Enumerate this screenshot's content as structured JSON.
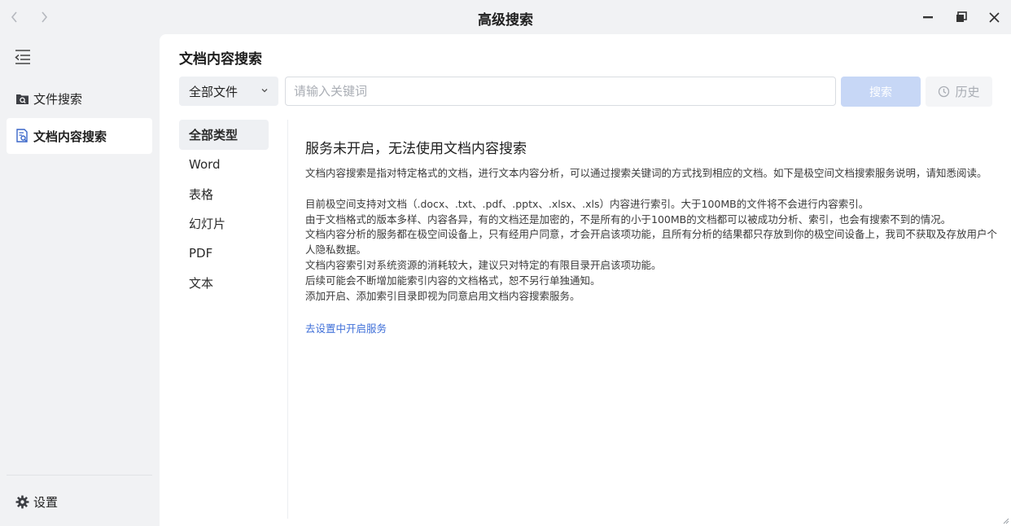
{
  "window": {
    "title": "高级搜索",
    "back_icon": "chevron-left-icon",
    "forward_icon": "chevron-right-icon"
  },
  "sidebar": {
    "items": [
      {
        "label": "文件搜索",
        "icon": "file-search-icon"
      },
      {
        "label": "文档内容搜索",
        "icon": "document-search-icon",
        "active": true
      }
    ],
    "settings_label": "设置"
  },
  "main": {
    "title": "文档内容搜索",
    "scope_select": {
      "value": "全部文件"
    },
    "search": {
      "placeholder": "请输入关键词",
      "value": ""
    },
    "search_button_label": "搜索",
    "history_label": "历史",
    "types": [
      "全部类型",
      "Word",
      "表格",
      "幻灯片",
      "PDF",
      "文本"
    ],
    "active_type": "全部类型",
    "content": {
      "heading": "服务未开启，无法使用文档内容搜索",
      "intro": "文档内容搜索是指对特定格式的文档，进行文本内容分析，可以通过搜索关键词的方式找到相应的文档。如下是极空间文档搜索服务说明，请知悉阅读。",
      "lines": [
        "目前极空间支持对文档（.docx、.txt、.pdf、.pptx、.xlsx、.xls）内容进行索引。大于100MB的文件将不会进行内容索引。",
        "由于文档格式的版本多样、内容各异，有的文档还是加密的，不是所有的小于100MB的文档都可以被成功分析、索引，也会有搜索不到的情况。",
        "文档内容分析的服务都在极空间设备上，只有经用户同意，才会开启该项功能，且所有分析的结果都只存放到你的极空间设备上，我司不获取及存放用户个人隐私数据。",
        "文档内容索引对系统资源的消耗较大，建议只对特定的有限目录开启该项功能。",
        "后续可能会不断增加能索引内容的文档格式，恕不另行单独通知。",
        "添加开启、添加索引目录即视为同意启用文档内容搜索服务。"
      ],
      "link": "去设置中开启服务"
    }
  },
  "colors": {
    "accent": "#3f6fd8",
    "search_button_disabled": "#c7d7f6",
    "sidebar_bg": "#f1f2f4"
  }
}
